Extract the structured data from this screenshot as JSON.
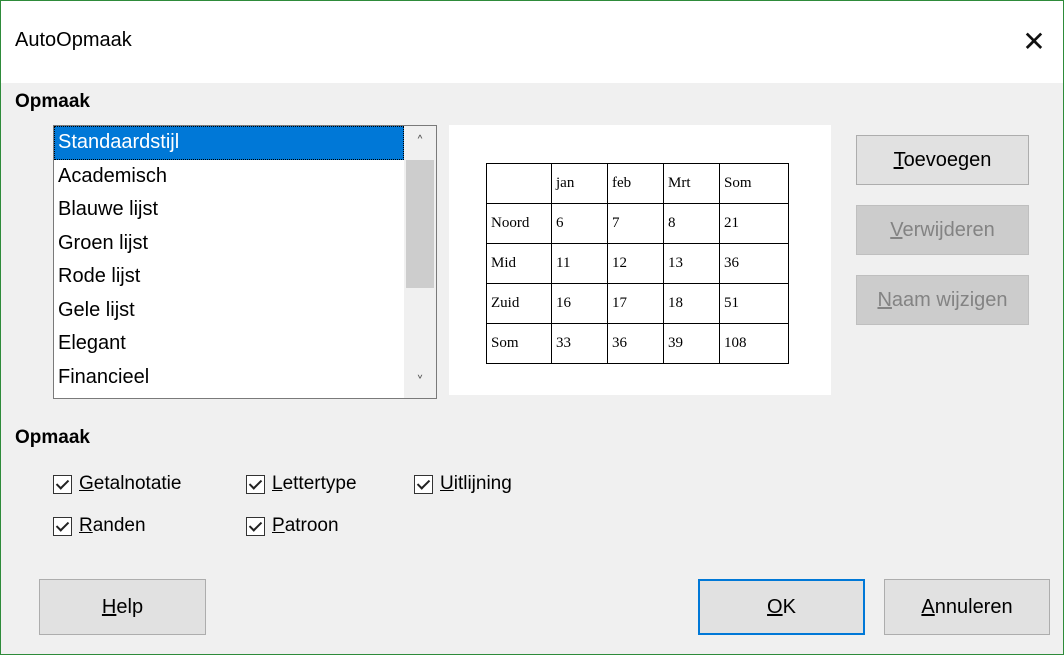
{
  "window": {
    "title": "AutoOpmaak",
    "close_glyph": "✕"
  },
  "format_section": {
    "label": "Opmaak",
    "styles": [
      "Standaardstijl",
      "Academisch",
      "Blauwe lijst",
      "Groen lijst",
      "Rode lijst",
      "Gele lijst",
      "Elegant",
      "Financieel"
    ],
    "selected_index": 0
  },
  "preview_table": {
    "header": [
      "",
      "jan",
      "feb",
      "Mrt",
      "Som"
    ],
    "rows": [
      [
        "Noord",
        "6",
        "7",
        "8",
        "21"
      ],
      [
        "Mid",
        "11",
        "12",
        "13",
        "36"
      ],
      [
        "Zuid",
        "16",
        "17",
        "18",
        "51"
      ],
      [
        "Som",
        "33",
        "36",
        "39",
        "108"
      ]
    ]
  },
  "side_buttons": {
    "add": {
      "accel": "T",
      "rest": "oevoegen"
    },
    "delete": {
      "accel": "V",
      "rest": "erwijderen"
    },
    "rename": {
      "accel": "N",
      "rest": "aam wijzigen"
    }
  },
  "options_section": {
    "label": "Opmaak",
    "number_format": {
      "accel": "G",
      "rest": "etalnotatie",
      "checked": true
    },
    "font": {
      "accel": "L",
      "rest": "ettertype",
      "checked": true
    },
    "alignment": {
      "accel": "U",
      "rest": "itlijning",
      "checked": true
    },
    "borders": {
      "accel": "R",
      "rest": "anden",
      "checked": true
    },
    "pattern": {
      "accel": "P",
      "rest": "atroon",
      "checked": true
    }
  },
  "bottom_buttons": {
    "help": {
      "accel": "H",
      "rest": "elp"
    },
    "ok": {
      "accel": "O",
      "rest": "K"
    },
    "cancel": {
      "accel": "A",
      "rest": "nnuleren"
    }
  },
  "colors": {
    "selection": "#0078d7",
    "window_border": "#2e8b3a"
  },
  "icons": {
    "scroll_up": "chevron-up-icon",
    "scroll_down": "chevron-down-icon",
    "close": "close-icon",
    "check": "checkmark-icon"
  }
}
